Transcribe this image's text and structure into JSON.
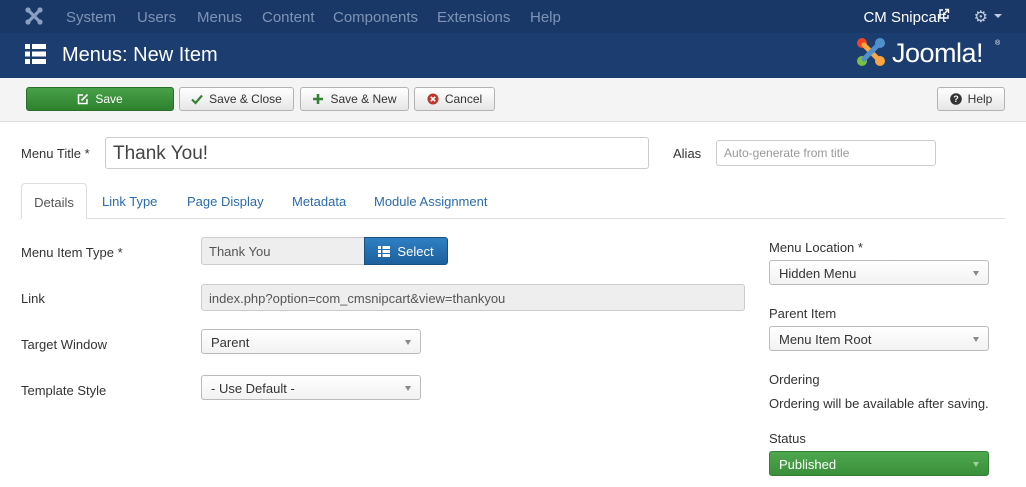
{
  "nav": {
    "items": [
      "System",
      "Users",
      "Menus",
      "Content",
      "Components",
      "Extensions",
      "Help"
    ],
    "site_name": "CM Snipcart"
  },
  "header": {
    "title": "Menus: New Item",
    "brand": "Joomla!",
    "brand_mark": "®"
  },
  "toolbar": {
    "save": "Save",
    "save_close": "Save & Close",
    "save_new": "Save & New",
    "cancel": "Cancel",
    "help": "Help"
  },
  "form": {
    "menu_title_label": "Menu Title *",
    "menu_title_value": "Thank You!",
    "alias_label": "Alias",
    "alias_placeholder": "Auto-generate from title"
  },
  "tabs": [
    "Details",
    "Link Type",
    "Page Display",
    "Metadata",
    "Module Assignment"
  ],
  "details": {
    "item_type_label": "Menu Item Type *",
    "item_type_value": "Thank You",
    "select_label": "Select",
    "link_label": "Link",
    "link_value": "index.php?option=com_cmsnipcart&view=thankyou",
    "target_label": "Target Window",
    "target_value": "Parent",
    "template_label": "Template Style",
    "template_value": "- Use Default -"
  },
  "sidebar": {
    "location_label": "Menu Location *",
    "location_value": "Hidden Menu",
    "parent_label": "Parent Item",
    "parent_value": "Menu Item Root",
    "ordering_label": "Ordering",
    "ordering_text": "Ordering will be available after saving.",
    "status_label": "Status",
    "status_value": "Published"
  },
  "colors": {
    "topbar": "#1a3867",
    "header": "#1c3d6f",
    "save_green": "#2e822e",
    "link_blue": "#2a6bac",
    "status_green": "#3a8f3a"
  }
}
